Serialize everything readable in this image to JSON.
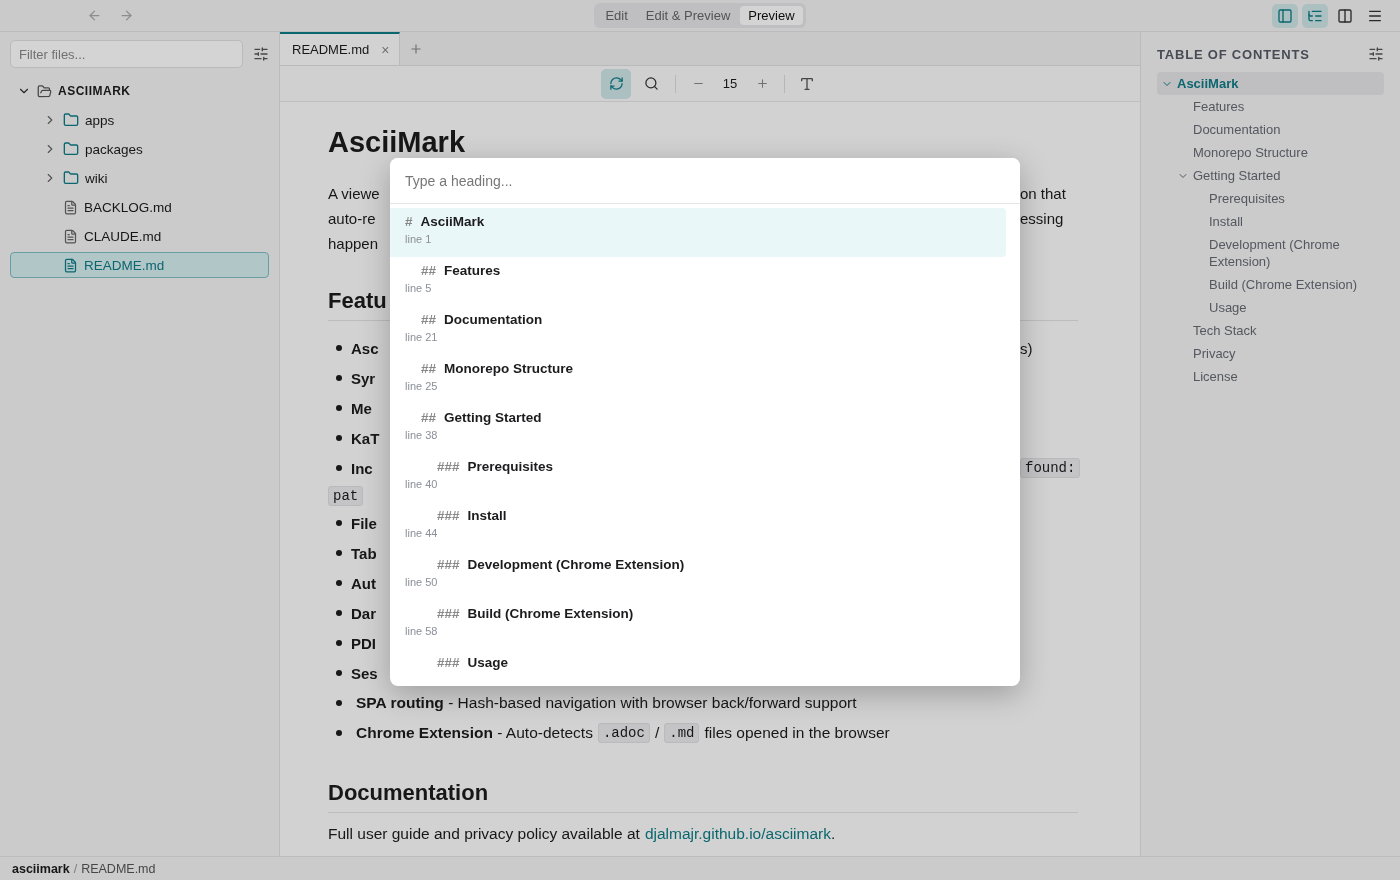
{
  "nav": {
    "back": {
      "disabled": true
    },
    "forward": {
      "disabled": true
    }
  },
  "modes": [
    {
      "label": "Edit",
      "selected": false
    },
    {
      "label": "Edit & Preview",
      "selected": false
    },
    {
      "label": "Preview",
      "selected": true
    }
  ],
  "view_toggles": [
    {
      "kind": "sidebar",
      "on": true
    },
    {
      "kind": "toc",
      "on": true
    },
    {
      "kind": "split",
      "on": false
    },
    {
      "kind": "menu",
      "on": false
    }
  ],
  "sidebar": {
    "filter_placeholder": "Filter files...",
    "tree": [
      {
        "name": "ASCIIMARK",
        "kind": "root",
        "expanded": true,
        "selected": false,
        "children": [
          {
            "name": "apps",
            "kind": "folder",
            "expanded": false,
            "selected": false
          },
          {
            "name": "packages",
            "kind": "folder",
            "expanded": false,
            "selected": false
          },
          {
            "name": "wiki",
            "kind": "folder",
            "expanded": false,
            "selected": false
          },
          {
            "name": "BACKLOG.md",
            "kind": "file",
            "selected": false
          },
          {
            "name": "CLAUDE.md",
            "kind": "file",
            "selected": false
          },
          {
            "name": "README.md",
            "kind": "file",
            "selected": true
          }
        ]
      }
    ]
  },
  "tabs": [
    {
      "label": "README.md",
      "selected": true,
      "close": "×"
    }
  ],
  "preview_toolbar": {
    "refresh_on": true,
    "font_size": "15"
  },
  "document": [
    {
      "kind": "h1",
      "text": "AsciiMark"
    },
    {
      "kind": "fragment",
      "bullet": false,
      "left": {
        "kind": "text",
        "text": "A viewe"
      },
      "right": {
        "kind": "text",
        "text": "on that"
      }
    },
    {
      "kind": "fragment",
      "bullet": false,
      "left": {
        "kind": "text",
        "text": "auto-re"
      },
      "right": {
        "kind": "text",
        "text": "essing"
      }
    },
    {
      "kind": "fragment",
      "bullet": false,
      "left": {
        "kind": "text",
        "text": "happen"
      }
    },
    {
      "kind": "h2",
      "text": "Featu"
    },
    {
      "kind": "fragment",
      "bullet": true,
      "left": {
        "kind": "bold",
        "text": "Asc"
      },
      "right": {
        "kind": "text",
        "text": "s)"
      }
    },
    {
      "kind": "fragment",
      "bullet": true,
      "left": {
        "kind": "bold",
        "text": "Syr"
      }
    },
    {
      "kind": "fragment",
      "bullet": true,
      "left": {
        "kind": "bold",
        "text": "Me"
      }
    },
    {
      "kind": "fragment",
      "bullet": true,
      "left": {
        "kind": "bold",
        "text": "KaT"
      }
    },
    {
      "kind": "fragment",
      "bullet": true,
      "left": {
        "kind": "bold",
        "text": "Inc"
      },
      "right": {
        "kind": "code",
        "text": "found:"
      }
    },
    {
      "kind": "fragment",
      "bullet": false,
      "left": {
        "kind": "code",
        "text": "pat"
      }
    },
    {
      "kind": "fragment",
      "bullet": true,
      "left": {
        "kind": "bold",
        "text": "File"
      }
    },
    {
      "kind": "fragment",
      "bullet": true,
      "left": {
        "kind": "bold",
        "text": "Tab"
      }
    },
    {
      "kind": "fragment",
      "bullet": true,
      "left": {
        "kind": "bold",
        "text": "Aut"
      }
    },
    {
      "kind": "fragment",
      "bullet": true,
      "left": {
        "kind": "bold",
        "text": "Dar"
      }
    },
    {
      "kind": "fragment",
      "bullet": true,
      "left": {
        "kind": "bold",
        "text": "PDI"
      }
    },
    {
      "kind": "fragment",
      "bullet": true,
      "left": {
        "kind": "bold",
        "text": "Ses"
      }
    },
    {
      "kind": "bullet",
      "parts": [
        {
          "kind": "text",
          "text": "**SPA routing** - Hash-based navigation with browser back/forward support"
        }
      ]
    },
    {
      "kind": "bullet",
      "parts": [
        {
          "kind": "text",
          "text": "**Chrome Extension** - Auto-detects"
        },
        {
          "kind": "code",
          "text": ".adoc"
        },
        {
          "kind": "text",
          "text": "/"
        },
        {
          "kind": "code",
          "text": ".md"
        },
        {
          "kind": "text",
          "text": "files opened in the browser"
        }
      ]
    },
    {
      "kind": "h2",
      "text": "Documentation"
    },
    {
      "kind": "paragraph",
      "parts": [
        {
          "kind": "text",
          "text": "Full user guide and privacy policy available at"
        },
        {
          "kind": "link",
          "text": "djalmajr.github.io/asciimark"
        },
        {
          "kind": "text",
          "text": "."
        }
      ]
    }
  ],
  "palette": {
    "placeholder": "Type a heading...",
    "items": [
      {
        "kind": "h1",
        "marker": "#",
        "title": "AsciiMark",
        "line": "line 1",
        "selected": true
      },
      {
        "kind": "h2",
        "marker": "##",
        "title": "Features",
        "line": "line 5",
        "selected": false
      },
      {
        "kind": "h2",
        "marker": "##",
        "title": "Documentation",
        "line": "line 21",
        "selected": false
      },
      {
        "kind": "h2",
        "marker": "##",
        "title": "Monorepo Structure",
        "line": "line 25",
        "selected": false
      },
      {
        "kind": "h2",
        "marker": "##",
        "title": "Getting Started",
        "line": "line 38",
        "selected": false
      },
      {
        "kind": "h3",
        "marker": "###",
        "title": "Prerequisites",
        "line": "line 40",
        "selected": false
      },
      {
        "kind": "h3",
        "marker": "###",
        "title": "Install",
        "line": "line 44",
        "selected": false
      },
      {
        "kind": "h3",
        "marker": "###",
        "title": "Development (Chrome Extension)",
        "line": "line 50",
        "selected": false
      },
      {
        "kind": "h3",
        "marker": "###",
        "title": "Build (Chrome Extension)",
        "line": "line 58",
        "selected": false
      },
      {
        "kind": "h3",
        "marker": "###",
        "title": "Usage",
        "selected": false
      }
    ]
  },
  "toc": {
    "title": "TABLE OF CONTENTS",
    "items": [
      {
        "label": "AsciiMark",
        "expanded": true,
        "selected": true,
        "children": [
          {
            "label": "Features",
            "selected": false
          },
          {
            "label": "Documentation",
            "selected": false
          },
          {
            "label": "Monorepo Structure",
            "selected": false
          },
          {
            "label": "Getting Started",
            "expanded": true,
            "selected": false,
            "children": [
              {
                "label": "Prerequisites",
                "selected": false
              },
              {
                "label": "Install",
                "selected": false
              },
              {
                "label": "Development (Chrome Extension)",
                "selected": false
              },
              {
                "label": "Build (Chrome Extension)",
                "selected": false
              },
              {
                "label": "Usage",
                "selected": false
              }
            ]
          },
          {
            "label": "Tech Stack",
            "selected": false
          },
          {
            "label": "Privacy",
            "selected": false
          },
          {
            "label": "License",
            "selected": false
          }
        ]
      }
    ]
  },
  "status_bar": {
    "project": "asciimark",
    "separator": "/",
    "file": "README.md"
  }
}
